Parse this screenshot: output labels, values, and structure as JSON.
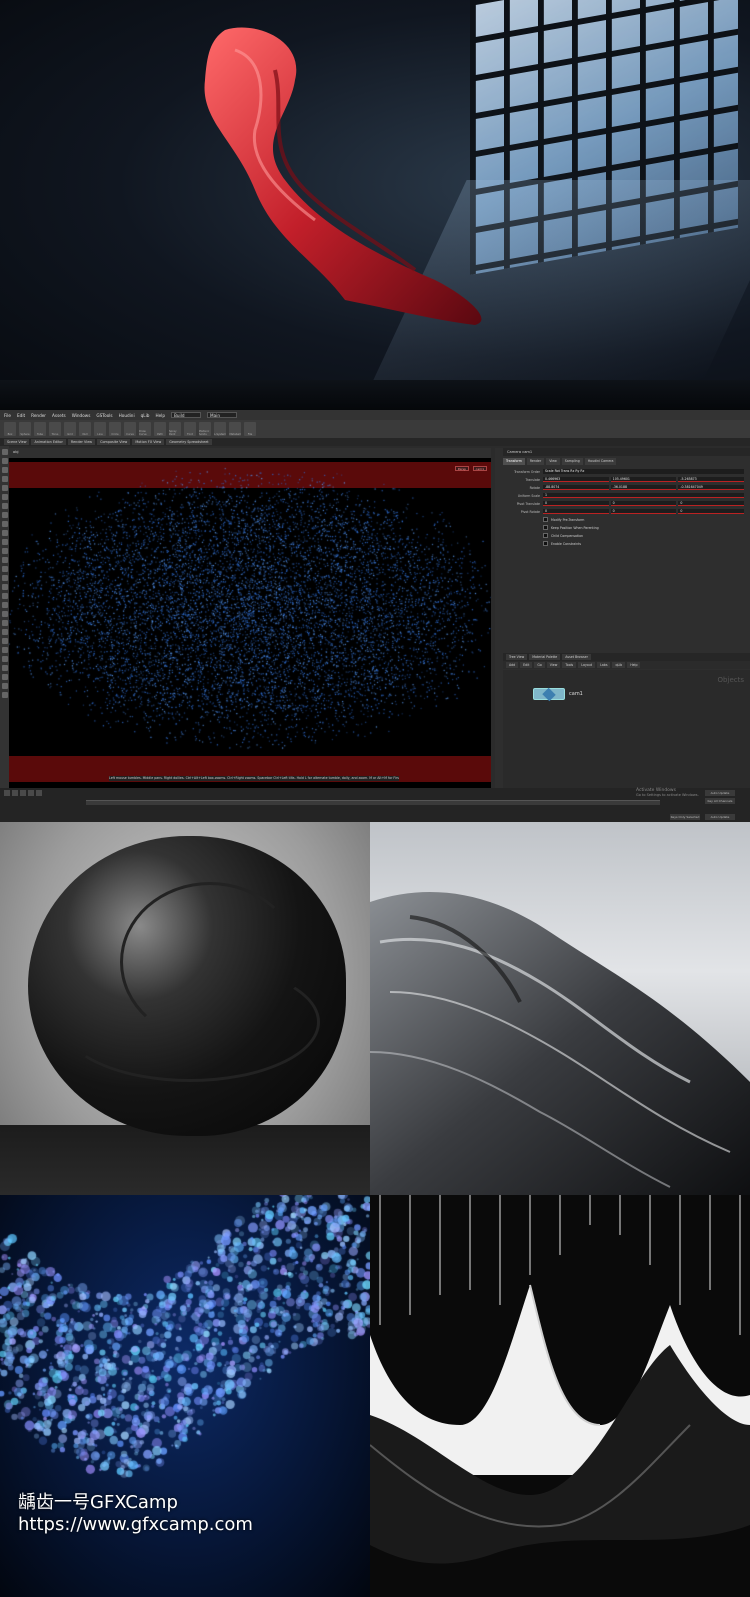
{
  "hero": {
    "alt": "Red silk cloth floating in dark room with window light"
  },
  "app": {
    "menu": [
      "File",
      "Edit",
      "Render",
      "Assets",
      "Windows",
      "GSTools",
      "Houdini",
      "qLib",
      "Help"
    ],
    "build_label": "Build",
    "desktop_label": "Main",
    "shelf_tools": [
      "Box",
      "Sphere",
      "Tube",
      "Torus",
      "Grid",
      "Null",
      "Line",
      "Circle",
      "Curve",
      "Draw Curve",
      "Path",
      "Spray Paint",
      "Font",
      "Platonic Solids",
      "L-System",
      "Metaball",
      "File"
    ],
    "shelf_tabs": [
      "Create",
      "Modify",
      "Model",
      "Polygon",
      "Deform",
      "Texture",
      "Rigging",
      "Characters",
      "Constraints",
      "Hair Utils",
      "Guide Process",
      "Terrain FX",
      "Simple FX",
      "Cloud FX",
      "Volume"
    ],
    "lower_tabs": [
      "Scene View",
      "Animation Editor",
      "Render View",
      "Composite View",
      "Motion FX View",
      "Geometry Spreadsheet"
    ],
    "viewport_path": "obj",
    "viewport_buttons": [
      "Persp",
      "cam1"
    ],
    "viewport_hint": "Left mouse tumbles. Middle pans. Right dollies. Ctrl+Alt+Left box-zooms. Ctrl+Right zooms. Spacebar Ctrl+Left tilts. Hold L for alternate tumble, dolly, and zoom.    M or Alt+M for First Person Navigation.",
    "param_path": "Camera  cam1",
    "param_tabs": [
      "Transform",
      "Render",
      "View",
      "Sampling",
      "Houdini Camera"
    ],
    "params": [
      {
        "label": "Transform Order",
        "value": "Scale Rot Trans   Rx Ry Rz"
      },
      {
        "label": "Translate",
        "values": [
          "0.466963",
          "105.49601",
          "-5.265873"
        ]
      },
      {
        "label": "Rotate",
        "values": [
          "-88.8074",
          "-36.0188",
          "-0.381647049"
        ]
      },
      {
        "label": "Uniform Scale",
        "values": [
          "1",
          "",
          ""
        ]
      },
      {
        "label": "Pivot Translate",
        "values": [
          "0",
          "0",
          "0"
        ]
      },
      {
        "label": "Pivot Rotate",
        "values": [
          "0",
          "0",
          "0"
        ]
      }
    ],
    "checks": [
      "Modify Pre-Transform",
      "Keep Position When Parenting",
      "Child Compensation",
      "Enable Constraints"
    ],
    "net_tabs": [
      "Tree View",
      "Material Palette",
      "Asset Browser"
    ],
    "net_path": "obj",
    "net_menu": [
      "Add",
      "Edit",
      "Go",
      "View",
      "Tools",
      "Layout",
      "Labs",
      "qLib",
      "Help"
    ],
    "net_context": "Objects",
    "node_label": "cam1",
    "watermark": [
      "Activate Windows",
      "Go to Settings to activate Windows."
    ],
    "buttons": [
      "Auto Update",
      "Key All Channels",
      "Keys Only Selected",
      "Auto Update"
    ]
  },
  "gallery": {
    "captions": [
      "Leather ball",
      "Crumpled fabric closeup",
      "Blue particle bokeh",
      "Hanging white drapes"
    ]
  },
  "credit": {
    "line1": "龋齿一号GFXCamp",
    "line2": "https://www.gfxcamp.com"
  },
  "colors": {
    "viewport_band": "#5a0a0a",
    "particle": "#2f6fd6",
    "node": "#7fb6c9"
  }
}
